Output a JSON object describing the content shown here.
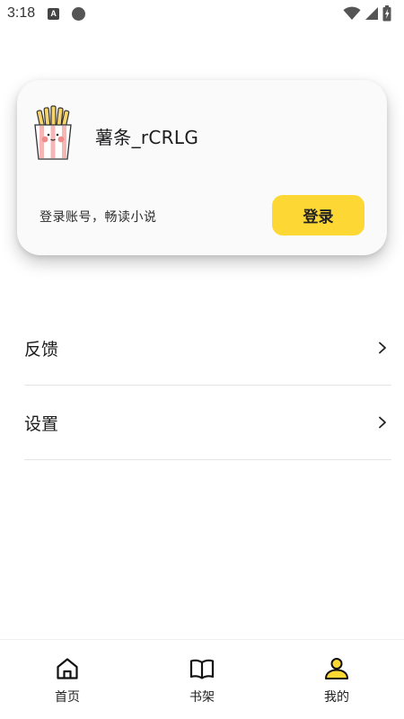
{
  "status_bar": {
    "time": "3:18",
    "notification_icon_letter": "A",
    "icons": [
      "a-notification-icon",
      "circle-notification-icon",
      "wifi-icon",
      "signal-icon",
      "battery-icon"
    ]
  },
  "profile_card": {
    "avatar_icon": "fries-avatar-icon",
    "username": "薯条_rCRLG",
    "login_hint": "登录账号，畅读小说",
    "login_button_label": "登录",
    "login_button_color": "#fdd835"
  },
  "menu": {
    "items": [
      {
        "label": "反馈",
        "icon": "chevron-right-icon"
      },
      {
        "label": "设置",
        "icon": "chevron-right-icon"
      }
    ]
  },
  "bottom_nav": {
    "items": [
      {
        "label": "首页",
        "icon": "home-icon",
        "active": false
      },
      {
        "label": "书架",
        "icon": "book-icon",
        "active": false
      },
      {
        "label": "我的",
        "icon": "profile-icon",
        "active": true
      }
    ],
    "active_color": "#fdd835"
  }
}
